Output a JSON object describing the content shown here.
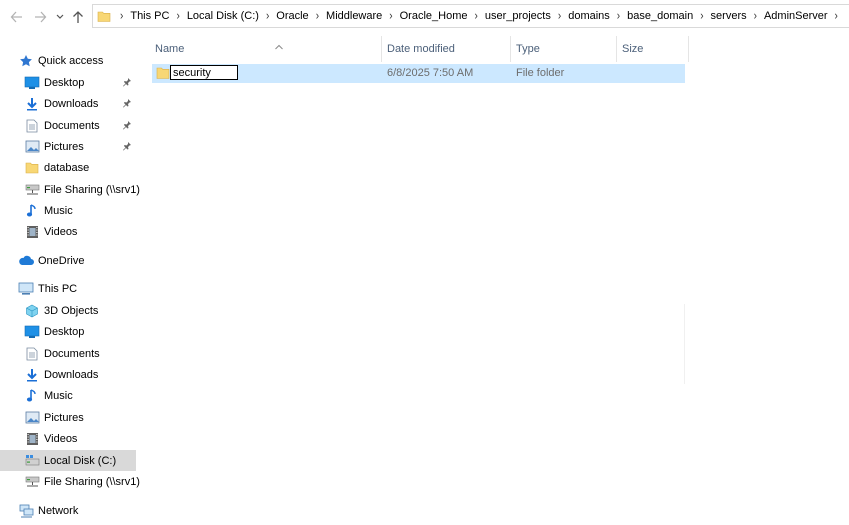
{
  "address": {
    "path": [
      "This PC",
      "Local Disk (C:)",
      "Oracle",
      "Middleware",
      "Oracle_Home",
      "user_projects",
      "domains",
      "base_domain",
      "servers",
      "AdminServer"
    ]
  },
  "sidebar": {
    "quick_access": "Quick access",
    "qa_items": [
      {
        "label": "Desktop",
        "pinned": true,
        "icon": "desktop-icon"
      },
      {
        "label": "Downloads",
        "pinned": true,
        "icon": "download-icon"
      },
      {
        "label": "Documents",
        "pinned": true,
        "icon": "documents-icon"
      },
      {
        "label": "Pictures",
        "pinned": true,
        "icon": "pictures-icon"
      },
      {
        "label": "database",
        "pinned": false,
        "icon": "folder-icon"
      },
      {
        "label": "File Sharing (\\\\srv1)",
        "pinned": false,
        "icon": "network-drive-icon"
      },
      {
        "label": "Music",
        "pinned": false,
        "icon": "music-icon"
      },
      {
        "label": "Videos",
        "pinned": false,
        "icon": "videos-icon"
      }
    ],
    "onedrive": "OneDrive",
    "this_pc": "This PC",
    "pc_items": [
      {
        "label": "3D Objects",
        "icon": "3d-objects-icon"
      },
      {
        "label": "Desktop",
        "icon": "desktop-icon"
      },
      {
        "label": "Documents",
        "icon": "documents-icon"
      },
      {
        "label": "Downloads",
        "icon": "download-icon"
      },
      {
        "label": "Music",
        "icon": "music-icon"
      },
      {
        "label": "Pictures",
        "icon": "pictures-icon"
      },
      {
        "label": "Videos",
        "icon": "videos-icon"
      },
      {
        "label": "Local Disk (C:)",
        "icon": "local-disk-icon",
        "selected": true
      },
      {
        "label": "File Sharing (\\\\srv1)",
        "icon": "network-drive-icon"
      }
    ],
    "network": "Network"
  },
  "columns": {
    "name": "Name",
    "date": "Date modified",
    "type": "Type",
    "size": "Size"
  },
  "files": [
    {
      "name": "security",
      "date": "6/8/2025 7:50 AM",
      "type": "File folder",
      "size": "",
      "renaming": true
    }
  ],
  "colors": {
    "selection": "#cce8ff",
    "sidebar_selected": "#d9d9d9",
    "folder": "#f8d775",
    "header_text": "#4c607a"
  }
}
